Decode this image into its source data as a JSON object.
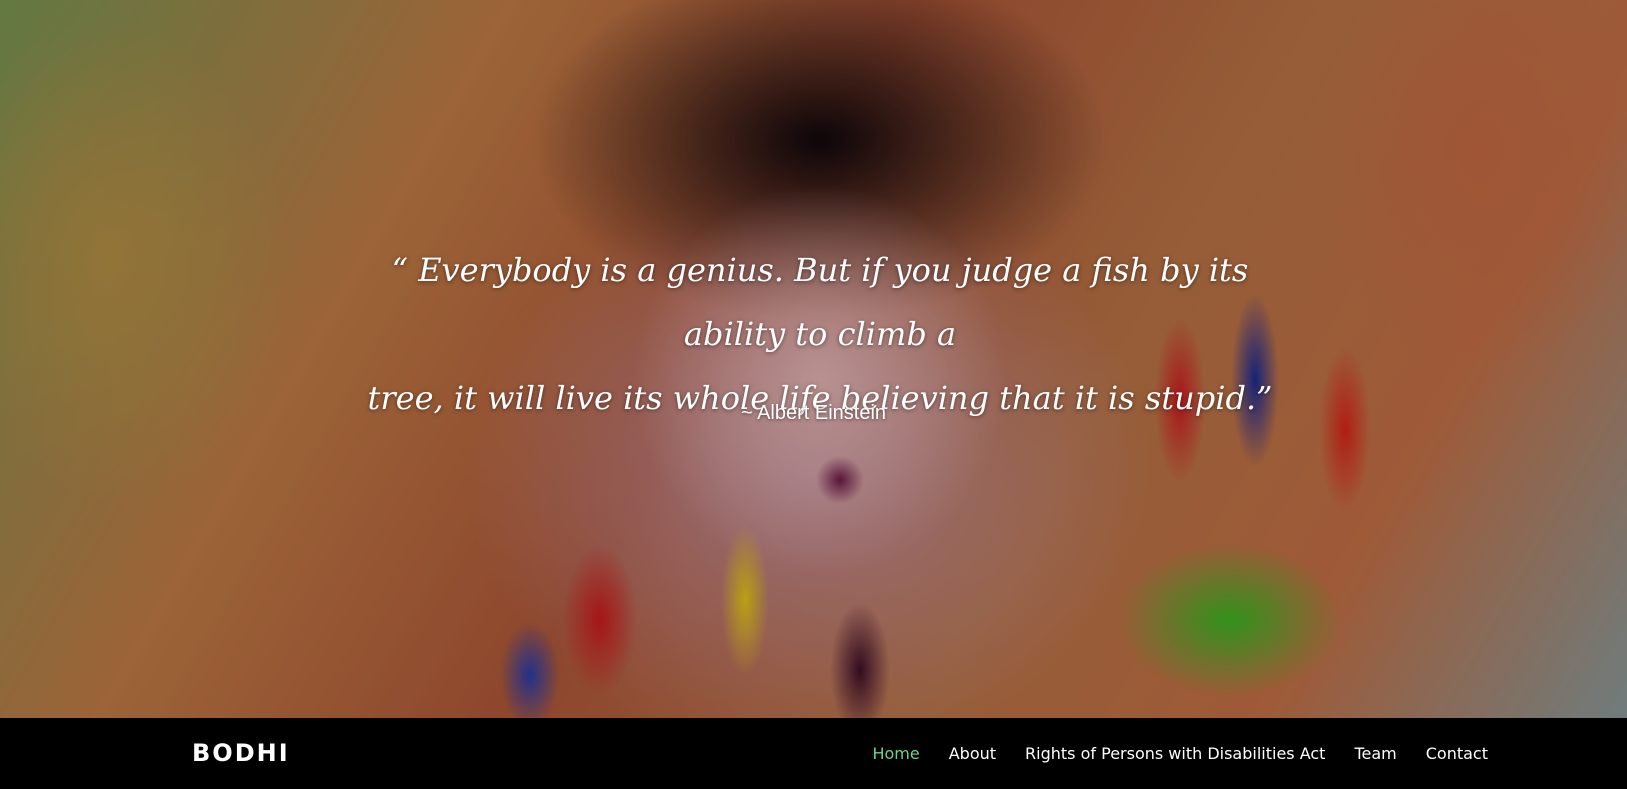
{
  "hero": {
    "quote_line1": "“ Everybody is a genius. But if you judge a fish by its ability to climb a",
    "quote_line2": "tree, it will live its whole life believing that it is stupid.”",
    "author": "~ Albert Einstein"
  },
  "navbar": {
    "brand": "BODHI",
    "links": [
      {
        "label": "Home",
        "active": true
      },
      {
        "label": "About",
        "active": false
      },
      {
        "label": "Rights of Persons with Disabilities Act",
        "active": false
      },
      {
        "label": "Team",
        "active": false
      },
      {
        "label": "Contact",
        "active": false
      }
    ]
  },
  "colors": {
    "navbar_bg": "#000000",
    "active_link": "#6fd08a",
    "text": "#ffffff"
  }
}
